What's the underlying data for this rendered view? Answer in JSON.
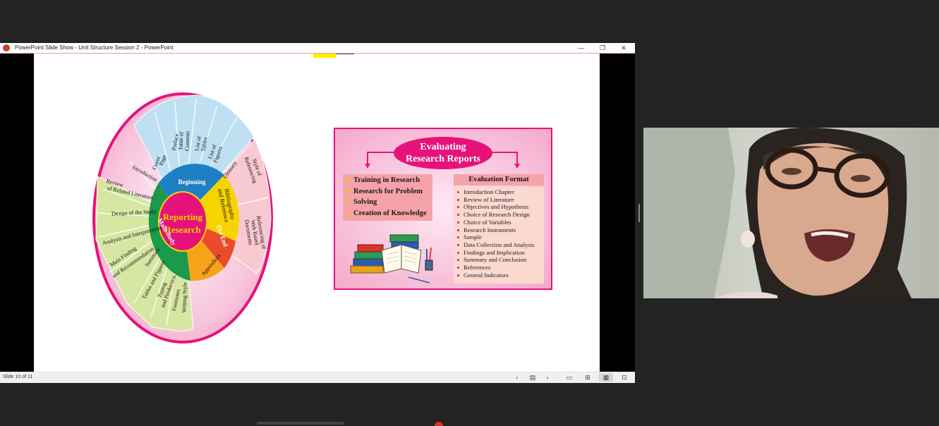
{
  "window": {
    "title": "PowerPoint Slide Show  -  Unit Structure Session 2 - PowerPoint",
    "minimize_icon": "—",
    "restore_icon": "❐",
    "close_icon": "✕"
  },
  "status": {
    "slide_counter": "Slide 10 of 11",
    "prev_icon": "‹",
    "notes_icon": "▤",
    "next_icon": "›",
    "normal_icon": "▭",
    "sorter_icon": "⊞",
    "reading_icon": "▦",
    "slideshow_icon": "⊡"
  },
  "wheel": {
    "center": [
      "Reporting",
      "Research"
    ],
    "sectors": {
      "beginning": "Beginning",
      "main_body": "Main Body",
      "the_end": "The End",
      "appendices": "Appendices",
      "bibliography": [
        "Bibliography",
        "and Reference"
      ]
    },
    "beginning_items": {
      "cover_page": [
        "Cover",
        "Page"
      ],
      "preface": "Preface",
      "toc": [
        "Table of",
        "Contents"
      ],
      "tables": [
        "List of",
        "Tables"
      ],
      "figures": [
        "List of",
        "Figures"
      ],
      "glossary": "Glossary"
    },
    "main_items": {
      "introduction": "Introduction",
      "review": [
        "Review",
        "of Related Literature"
      ],
      "design": "Design of the Study",
      "analysis": "Analysis and Interpretation",
      "finding": [
        "Main Finding",
        "and Recommendation"
      ],
      "summary": "Summary",
      "tables_figures": "Tables and Figures",
      "typing": [
        "Typing",
        "and Production"
      ],
      "footnotes": "Footnotes",
      "writing_style": "Writing Style"
    },
    "end_items": {
      "style_ref": [
        "Style of",
        "Referencing"
      ],
      "web_ref": [
        "Referencing of",
        "Web Based",
        "Documents"
      ]
    }
  },
  "evaluation": {
    "title": [
      "Evaluating",
      "Research Reports"
    ],
    "left_items": [
      "Training in Research",
      "Research for Problem",
      "Solving",
      "Creation of Knowledge"
    ],
    "format_heading": "Evaluation Format",
    "format_items": [
      "Introduction Chapter",
      "Review of Literature",
      "Objectives and Hypothesis",
      "Choice of Research Design",
      "Choice of Variables",
      "Research Instruments",
      "Sample",
      "Data Collection and Analysis",
      "Findings and Implication",
      "Summary and Conclusion",
      "References",
      "General Indicators"
    ]
  },
  "colors": {
    "accent_pink": "#e6127a",
    "beginning_blue": "#1f7fc4",
    "main_green": "#1a9a4a",
    "end_red": "#e94b2b",
    "appendices_orange": "#f6a31a",
    "bib_yellow": "#f7d300"
  }
}
